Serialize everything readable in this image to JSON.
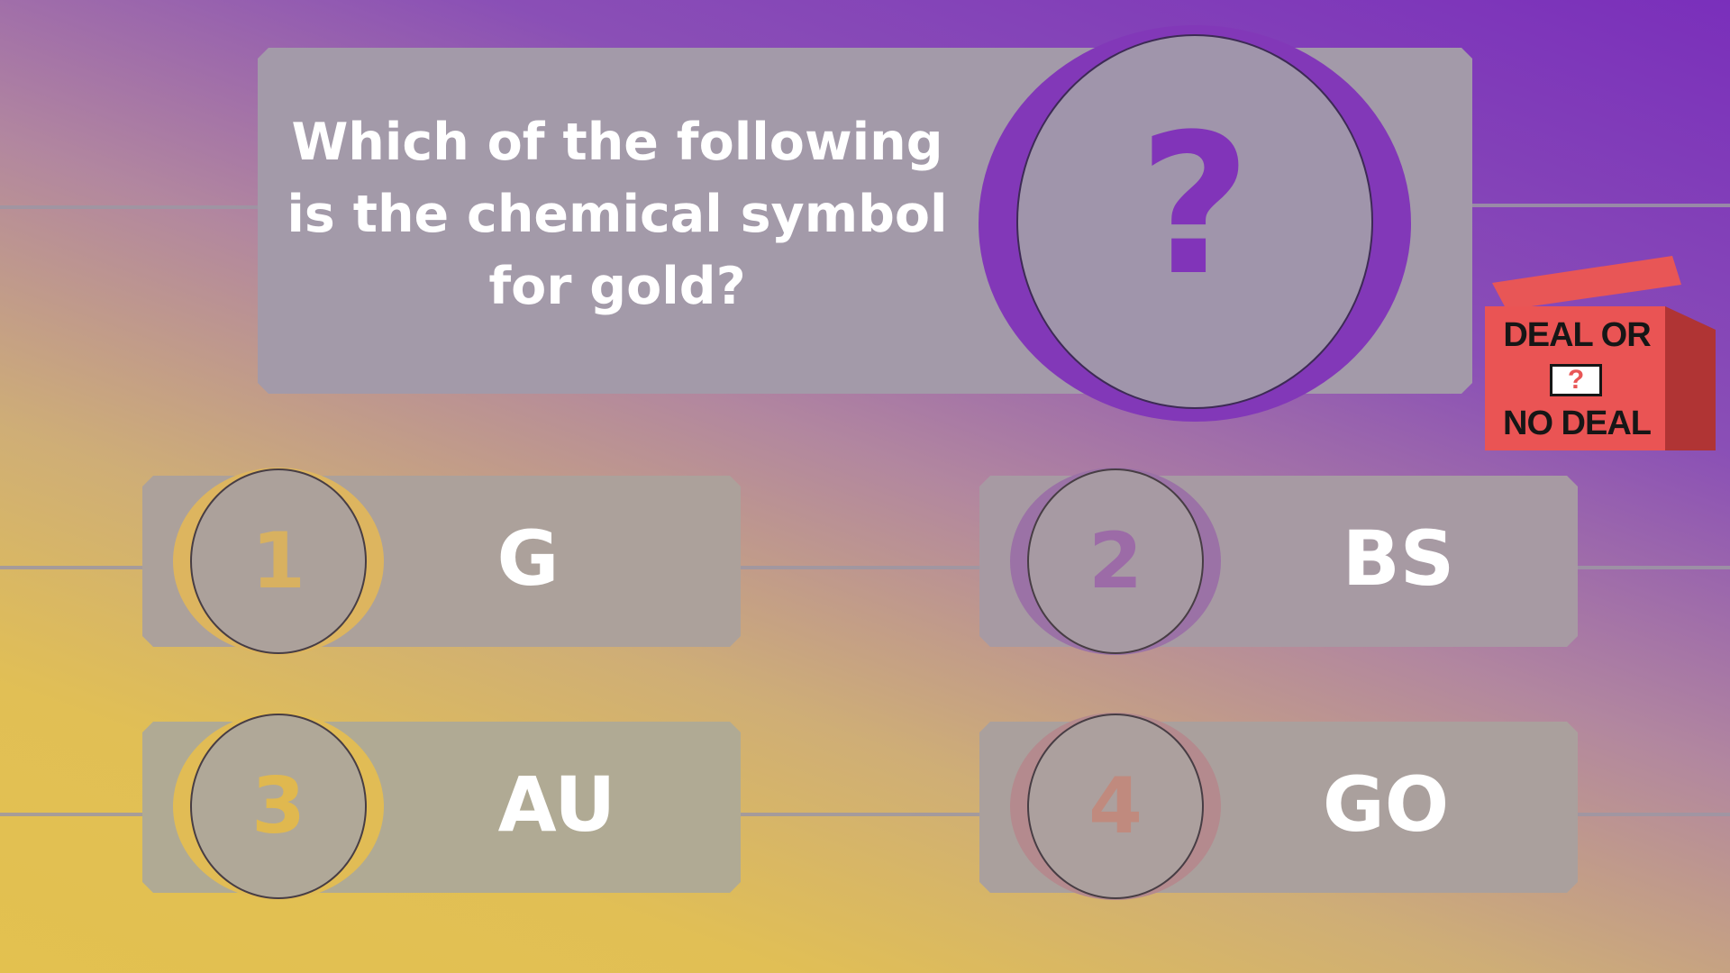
{
  "question": {
    "text": "Which of the following is the chemical symbol for gold?",
    "mark": "?"
  },
  "answers": [
    {
      "number": "1",
      "text": "G"
    },
    {
      "number": "2",
      "text": "BS"
    },
    {
      "number": "3",
      "text": "AU"
    },
    {
      "number": "4",
      "text": "GO"
    }
  ],
  "logo": {
    "line1": "DEAL OR",
    "mark": "?",
    "line2": "NO DEAL"
  },
  "colors": {
    "background_top_right": "#7a2fbb",
    "background_bottom_left": "#e3c14f",
    "panel": "#a79fab",
    "accent_purple": "#8134b9",
    "accent_gold": "#e1bc55",
    "text": "#ffffff",
    "logo_red": "#ea5454"
  }
}
